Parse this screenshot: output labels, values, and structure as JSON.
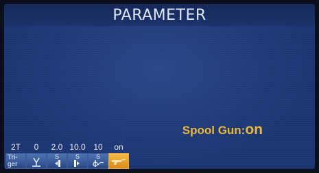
{
  "header": {
    "title": "PARAMETER"
  },
  "status": {
    "label": "Spool Gun:",
    "value": "on"
  },
  "params": {
    "values": [
      "2T",
      "0",
      "2.0",
      "10.0",
      "10",
      "on"
    ],
    "buttons": [
      {
        "label": "Tri-\nger",
        "icon": "trigger-mode-icon"
      },
      {
        "label": "",
        "icon": "preflow-gas-icon"
      },
      {
        "label": "S",
        "icon": "wire-inch-down-icon"
      },
      {
        "label": "S",
        "icon": "wire-inch-up-icon"
      },
      {
        "label": "S",
        "icon": "burnback-icon"
      },
      {
        "label": "",
        "icon": "spool-gun-trigger-icon"
      }
    ]
  },
  "colors": {
    "screen": "#1e3775",
    "accent": "#e9b93a",
    "button": "#3b5ea2",
    "button_active": "#e9a63a"
  }
}
